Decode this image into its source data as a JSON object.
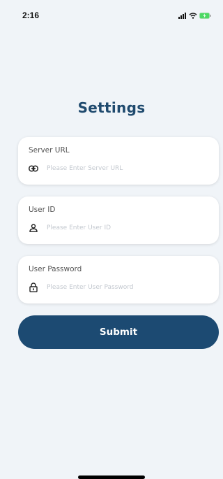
{
  "status_bar": {
    "time": "2:16"
  },
  "page": {
    "title": "Settings"
  },
  "form": {
    "server_url": {
      "label": "Server URL",
      "placeholder": "Please Enter Server URL",
      "value": "",
      "icon": "link-icon"
    },
    "user_id": {
      "label": "User ID",
      "placeholder": "Please Enter User ID",
      "value": "",
      "icon": "user-icon"
    },
    "user_password": {
      "label": "User Password",
      "placeholder": "Please Enter User Password",
      "value": "",
      "icon": "lock-icon"
    },
    "submit_label": "Submit"
  },
  "colors": {
    "background": "#f0f4f8",
    "title": "#1f4a6e",
    "button": "#1c4a72",
    "battery_charging": "#4cd964"
  }
}
